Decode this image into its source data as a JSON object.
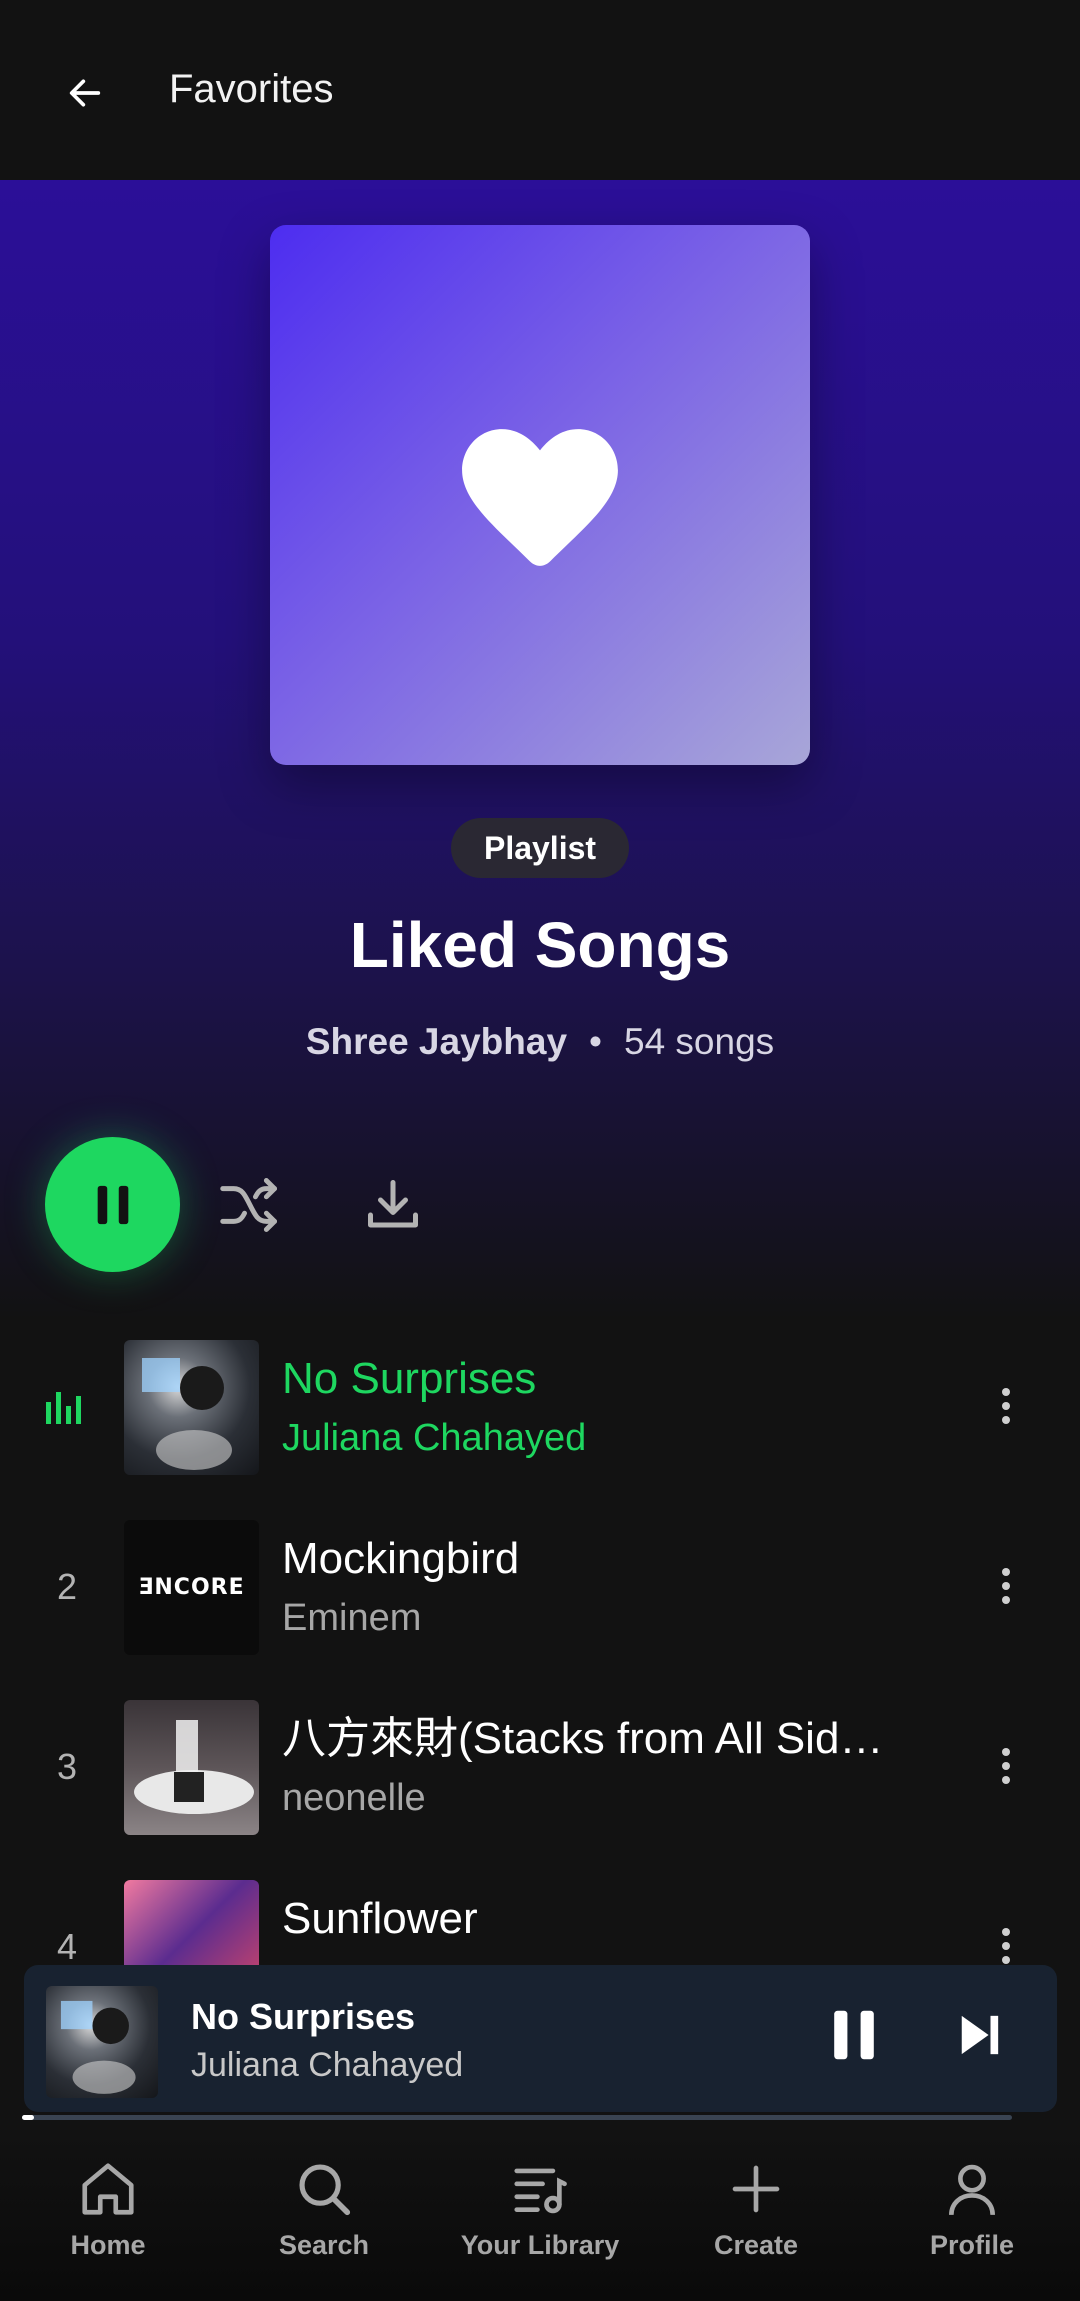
{
  "header": {
    "title": "Favorites"
  },
  "playlist": {
    "type_label": "Playlist",
    "title": "Liked Songs",
    "owner": "Shree Jaybhay",
    "separator": "•",
    "song_count": "54 songs"
  },
  "tracks": [
    {
      "number": "",
      "title": "No Surprises",
      "artist": "Juliana Chahayed",
      "playing": true
    },
    {
      "number": "2",
      "title": "Mockingbird",
      "artist": "Eminem",
      "cover_text": "ƎNCORE"
    },
    {
      "number": "3",
      "title": "八方來財(Stacks from All Sid…",
      "artist": "neonelle"
    },
    {
      "number": "4",
      "title": "Sunflower",
      "artist": ""
    }
  ],
  "now_playing": {
    "title": "No Surprises",
    "artist": "Juliana Chahayed",
    "progress_fraction": 0.012
  },
  "nav": [
    {
      "label": "Home",
      "icon": "home-icon"
    },
    {
      "label": "Search",
      "icon": "search-icon"
    },
    {
      "label": "Your Library",
      "icon": "library-icon"
    },
    {
      "label": "Create",
      "icon": "plus-icon"
    },
    {
      "label": "Profile",
      "icon": "profile-icon"
    }
  ],
  "colors": {
    "accent": "#1ed760",
    "hero": "#2b0f98",
    "background": "#121212",
    "miniplayer": "#182230"
  }
}
